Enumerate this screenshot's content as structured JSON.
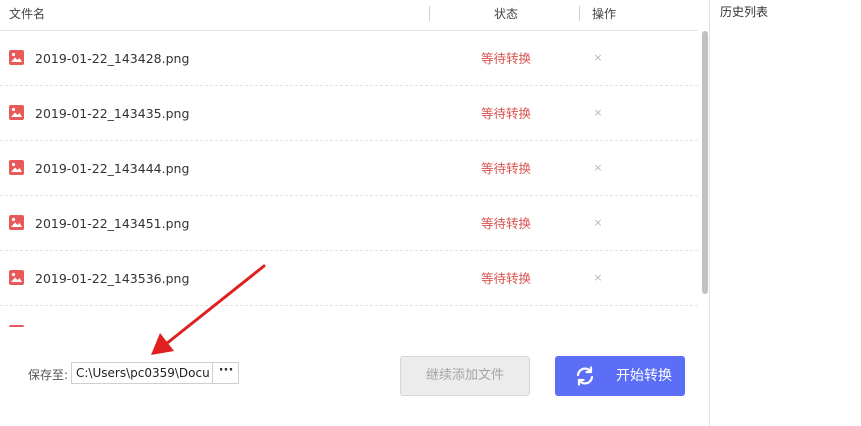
{
  "header": {
    "filename_col": "文件名",
    "status_col": "状态",
    "action_col": "操作"
  },
  "files": [
    {
      "name": "2019-01-22_143428.png",
      "status": "等待转换"
    },
    {
      "name": "2019-01-22_143435.png",
      "status": "等待转换"
    },
    {
      "name": "2019-01-22_143444.png",
      "status": "等待转换"
    },
    {
      "name": "2019-01-22_143451.png",
      "status": "等待转换"
    },
    {
      "name": "2019-01-22_143536.png",
      "status": "等待转换"
    }
  ],
  "delete_glyph": "×",
  "sidebar": {
    "title": "历史列表"
  },
  "save": {
    "label": "保存至:",
    "path": "C:\\Users\\pc0359\\Docu",
    "browse_label": "···"
  },
  "buttons": {
    "add_files": "继续添加文件",
    "start": "开始转换"
  },
  "colors": {
    "accent": "#5b6ef5",
    "status": "#d9534f",
    "file_icon": "#e85a5a",
    "arrow": "#e02020"
  },
  "icons": {
    "file": "image-file-icon",
    "start": "refresh-icon",
    "delete": "close-icon"
  }
}
